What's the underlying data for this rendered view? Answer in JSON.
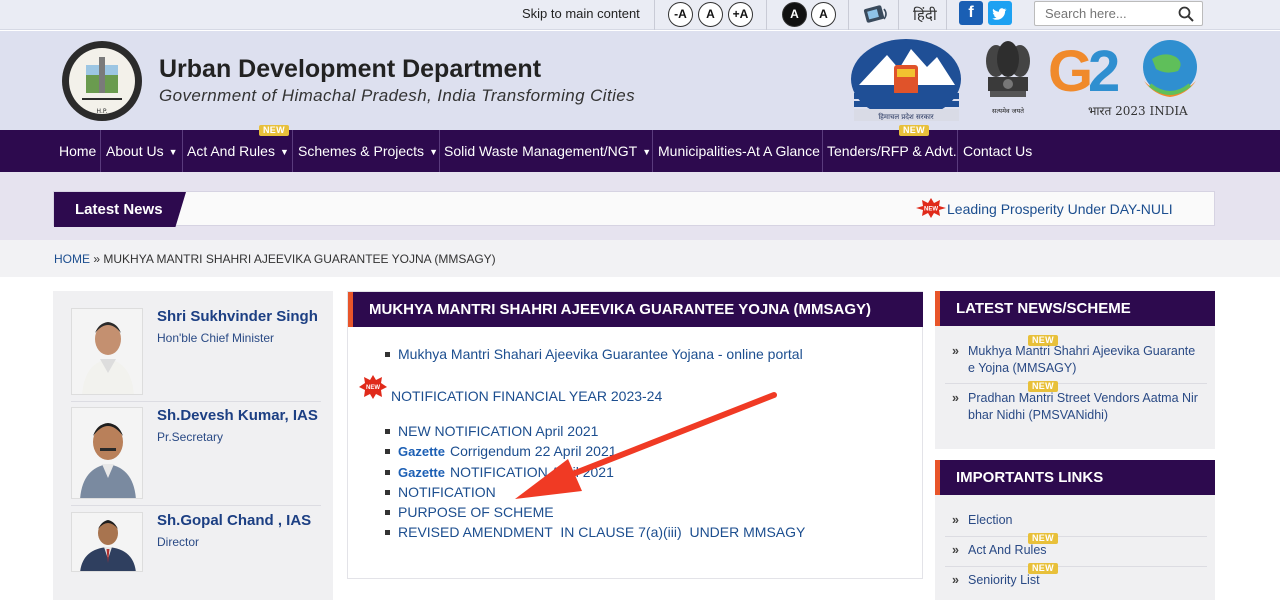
{
  "topbar": {
    "skip_link": "Skip to main content",
    "font_buttons": [
      "-A",
      "A",
      "+A"
    ],
    "contrast_buttons": [
      "A",
      "A"
    ],
    "language_link": "हिंदी",
    "social": {
      "facebook": "f",
      "twitter": "t"
    },
    "search_placeholder": "Search here...",
    "icons": [
      "text-to-speech-icon",
      "facebook-icon",
      "twitter-icon",
      "search-icon"
    ]
  },
  "header": {
    "title": "Urban Development Department",
    "subtitle": "Government of Himachal Pradesh, India Transforming Cities",
    "logos": {
      "dept_logo_text": "Urban Development Department H.P.",
      "hp_logo_text": "हिमाचल प्रदेश सरकार",
      "emblem_text": "सत्यमेव जयते",
      "g20_text": "G20",
      "g20_sub": "भारत 2023 INDIA"
    }
  },
  "nav": {
    "items": [
      {
        "label": "Home",
        "dropdown": false,
        "new": false
      },
      {
        "label": "About Us",
        "dropdown": true,
        "new": false
      },
      {
        "label": "Act And Rules",
        "dropdown": true,
        "new": true
      },
      {
        "label": "Schemes & Projects",
        "dropdown": true,
        "new": false
      },
      {
        "label": "Solid Waste Management/NGT",
        "dropdown": true,
        "new": false
      },
      {
        "label": "Municipalities-At A Glance",
        "dropdown": false,
        "new": false
      },
      {
        "label": "Tenders/RFP & Advt.",
        "dropdown": false,
        "new": true
      },
      {
        "label": "Contact Us",
        "dropdown": false,
        "new": false
      }
    ],
    "new_badge": "NEW"
  },
  "latest_news": {
    "label": "Latest News",
    "ticker_text": "Leading Prosperity Under DAY-NULI"
  },
  "breadcrumb": {
    "home": "HOME",
    "separator": "»",
    "current": "MUKHYA MANTRI SHAHRI AJEEVIKA GUARANTEE YOJNA (MMSAGY)"
  },
  "officials": [
    {
      "name": "Shri Sukhvinder Singh",
      "role": "Hon'ble Chief Minister"
    },
    {
      "name": "Sh.Devesh Kumar, IAS",
      "role": "Pr.Secretary"
    },
    {
      "name": "Sh.Gopal Chand , IAS",
      "role": "Director"
    }
  ],
  "content": {
    "heading": "MUKHYA MANTRI SHAHRI AJEEVIKA GUARANTEE YOJNA (MMSAGY)",
    "portal_link": "Mukhya Mantri Shahari Ajeevika Guarantee Yojana - online portal",
    "notification_heading": "NOTIFICATION FINANCIAL YEAR 2023-24",
    "new_flash": "NEW",
    "links": [
      {
        "prefix": "",
        "text": "NEW NOTIFICATION April 2021"
      },
      {
        "prefix": "Gazette",
        "text": "Corrigendum 22 April 2021"
      },
      {
        "prefix": "Gazette",
        "text": "NOTIFICATION April 2021"
      },
      {
        "prefix": "",
        "text": "NOTIFICATION"
      },
      {
        "prefix": "",
        "text": "PURPOSE OF SCHEME"
      },
      {
        "prefix": "",
        "text": "REVISED AMENDMENT  IN CLAUSE 7(a)(iii)  UNDER MMSAGY"
      }
    ],
    "annotation": "red-arrow pointing to PURPOSE OF SCHEME"
  },
  "sidebar_news": {
    "heading": "LATEST NEWS/SCHEME",
    "items": [
      {
        "text": "Mukhya Mantri Shahri Ajeevika Guarante e Yojna (MMSAGY)",
        "new": true
      },
      {
        "text": "Pradhan Mantri Street Vendors Aatma Nir bhar Nidhi (PMSVANidhi)",
        "new": true
      }
    ]
  },
  "important_links": {
    "heading": "IMPORTANTS LINKS",
    "items": [
      {
        "text": "Election",
        "new": false
      },
      {
        "text": "Act And Rules",
        "new": true
      },
      {
        "text": "Seniority List",
        "new": true
      }
    ]
  },
  "colors": {
    "nav_bg": "#2d0a4e",
    "header_bg": "#dde0ef",
    "accent_orange": "#e8552a",
    "link_blue": "#1c4e8f",
    "new_badge": "#e8c03a",
    "annotation_red": "#f03a24"
  }
}
